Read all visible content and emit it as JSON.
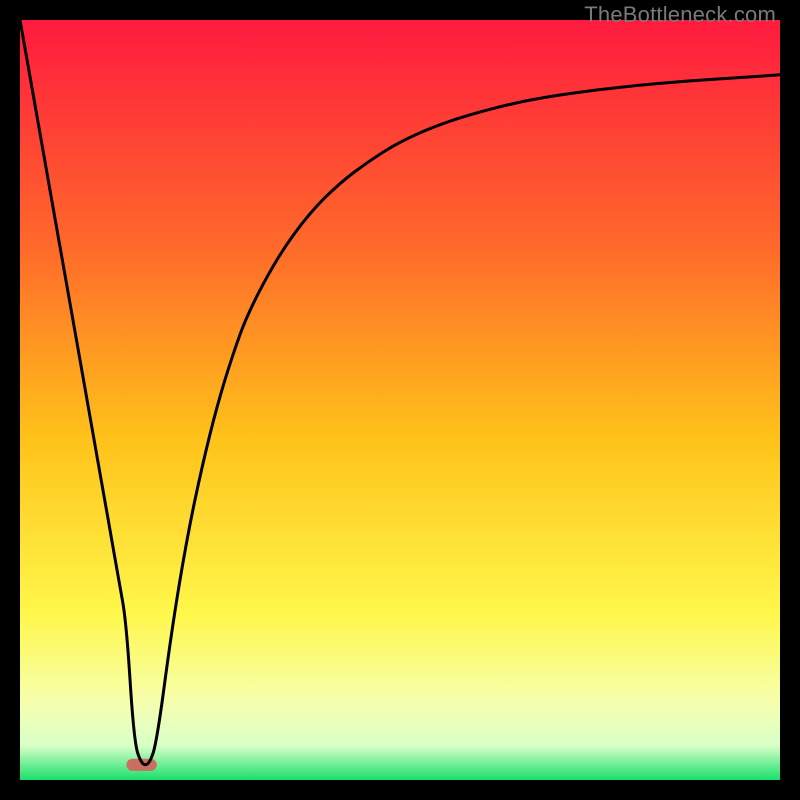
{
  "watermark": "TheBottleneck.com",
  "chart_data": {
    "type": "line",
    "title": "",
    "xlabel": "",
    "ylabel": "",
    "xlim": [
      0,
      100
    ],
    "ylim": [
      0,
      100
    ],
    "grid": false,
    "legend": false,
    "gradient_stops": [
      {
        "offset": 0.0,
        "color": "#ff1a3f"
      },
      {
        "offset": 0.3,
        "color": "#ff6a2a"
      },
      {
        "offset": 0.55,
        "color": "#ffc21a"
      },
      {
        "offset": 0.78,
        "color": "#fff74a"
      },
      {
        "offset": 0.9,
        "color": "#f6ffb0"
      },
      {
        "offset": 0.955,
        "color": "#d8ffc8"
      },
      {
        "offset": 1.0,
        "color": "#18e06a"
      }
    ],
    "series": [
      {
        "name": "curve",
        "color": "#000000",
        "x": [
          0,
          2,
          4,
          6,
          8,
          10,
          11,
          12,
          13,
          14,
          15,
          16,
          17,
          18,
          20,
          22,
          24,
          26,
          28,
          30,
          34,
          38,
          42,
          46,
          50,
          55,
          60,
          66,
          72,
          80,
          88,
          96,
          100
        ],
        "y": [
          100,
          88.7,
          77.3,
          66.0,
          54.7,
          43.3,
          37.7,
          32.0,
          26.3,
          20.7,
          5.0,
          2.0,
          2.0,
          5.0,
          20.0,
          32.0,
          41.5,
          49.5,
          56.0,
          61.5,
          69.0,
          74.5,
          78.5,
          81.5,
          84.0,
          86.2,
          87.8,
          89.3,
          90.3,
          91.3,
          92.0,
          92.5,
          92.8
        ]
      }
    ],
    "marker": {
      "name": "valley-marker",
      "color": "#cc6d61",
      "cx": 16.0,
      "cy": 2.0,
      "width_x": 4.0,
      "height_y": 1.6
    }
  }
}
